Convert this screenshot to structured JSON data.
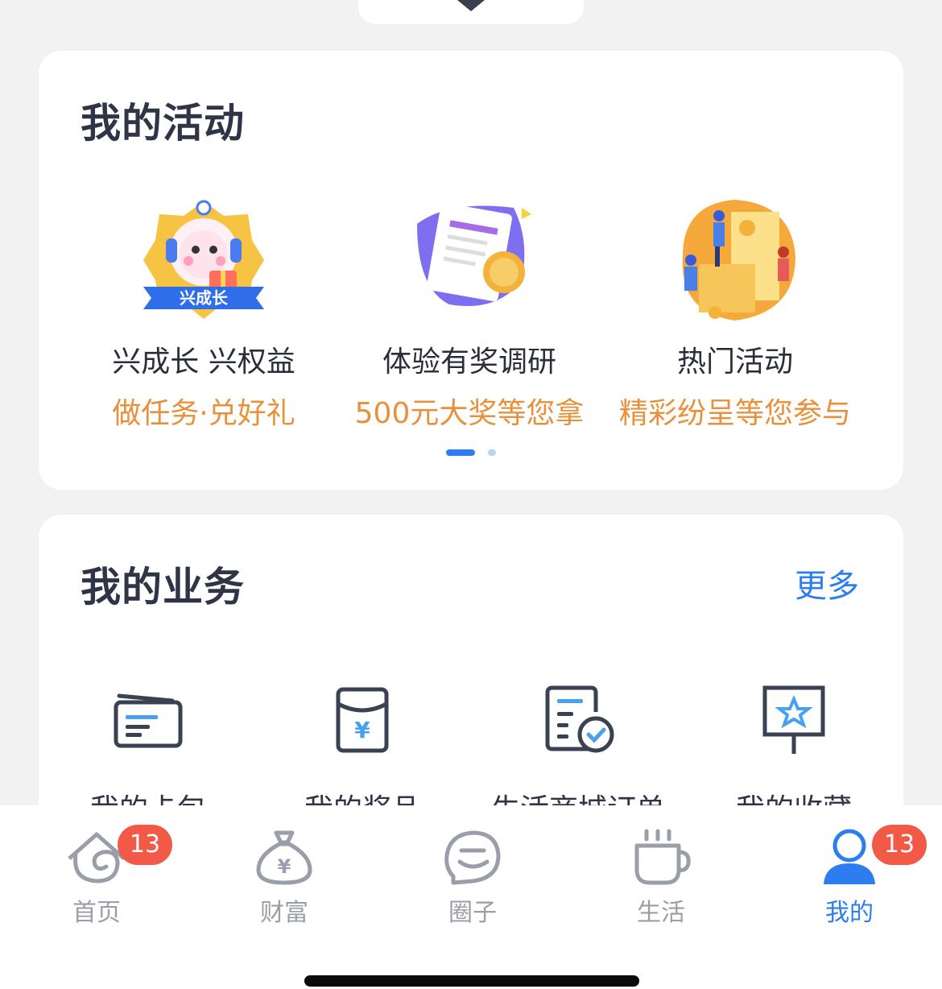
{
  "activity": {
    "title": "我的活动",
    "items": [
      {
        "title": "兴成长 兴权益",
        "subtitle": "做任务·兑好礼",
        "banner_text": "兴成长",
        "icon": "robot-mascot-icon"
      },
      {
        "title": "体验有奖调研",
        "subtitle": "500元大奖等您拿",
        "icon": "survey-document-icon"
      },
      {
        "title": "热门活动",
        "subtitle": "精彩纷呈等您参与",
        "icon": "popular-event-icon"
      }
    ],
    "pager": {
      "pages": 2,
      "current": 1
    }
  },
  "business": {
    "title": "我的业务",
    "more_label": "更多",
    "items": [
      {
        "label": "我的卡包",
        "icon": "card-wallet-icon"
      },
      {
        "label": "我的奖品",
        "icon": "red-envelope-icon"
      },
      {
        "label": "生活商城订单",
        "icon": "order-check-icon"
      },
      {
        "label": "我的收藏",
        "icon": "star-board-icon"
      }
    ]
  },
  "tabbar": {
    "tabs": [
      {
        "label": "首页",
        "badge": "13",
        "icon": "home-icon"
      },
      {
        "label": "财富",
        "icon": "money-bag-icon"
      },
      {
        "label": "圈子",
        "icon": "chat-circle-icon"
      },
      {
        "label": "生活",
        "icon": "coffee-cup-icon"
      },
      {
        "label": "我的",
        "badge": "13",
        "icon": "user-icon",
        "active": true
      }
    ]
  },
  "colors": {
    "accent": "#2d7cf0",
    "orange_text": "#e8913a",
    "badge": "#f25a47",
    "title": "#2f3446",
    "background": "#f2f2f2"
  }
}
